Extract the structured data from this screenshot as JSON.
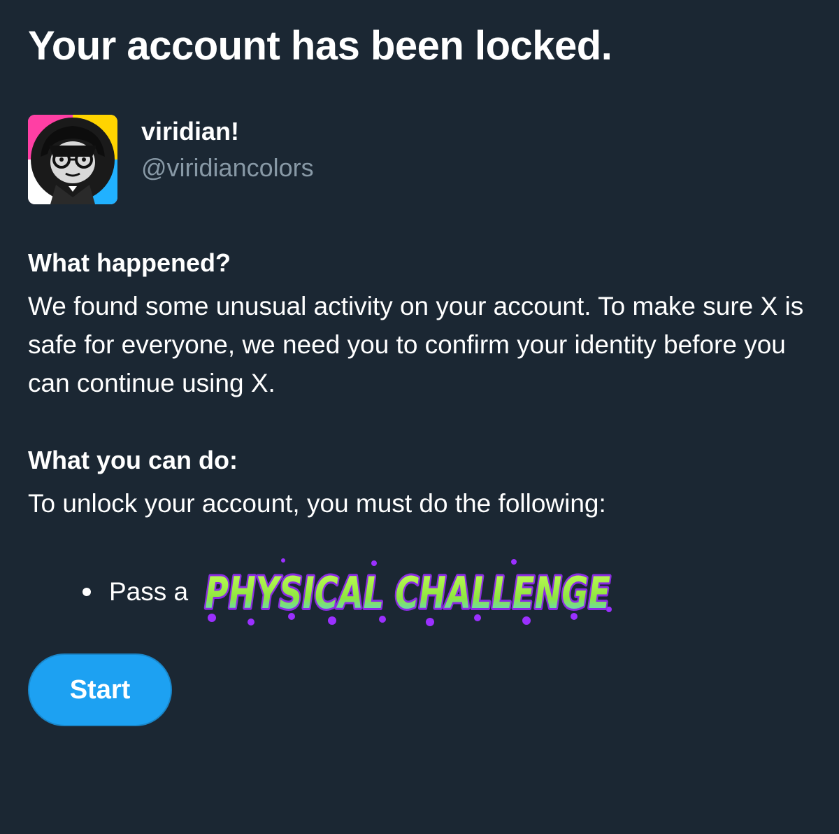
{
  "page": {
    "title": "Your account has been locked."
  },
  "profile": {
    "display_name": "viridian!",
    "handle": "@viridiancolors",
    "avatar_icon": "avatar-image"
  },
  "what_happened": {
    "heading": "What happened?",
    "body": "We found some unusual activity on your account. To make sure X is safe for everyone, we need you to confirm your identity before you can continue using X."
  },
  "what_you_can_do": {
    "heading": "What you can do:",
    "body": "To unlock your account, you must do the following:",
    "steps": [
      {
        "prefix": "Pass a",
        "stylized_text": "PHYSICAL CHALLENGE"
      }
    ]
  },
  "actions": {
    "start_label": "Start"
  },
  "colors": {
    "background": "#1b2733",
    "text": "#ffffff",
    "muted_text": "#8899a6",
    "accent": "#1da1f2",
    "challenge_fill": "#9be84a",
    "challenge_outline": "#8a2be2"
  }
}
